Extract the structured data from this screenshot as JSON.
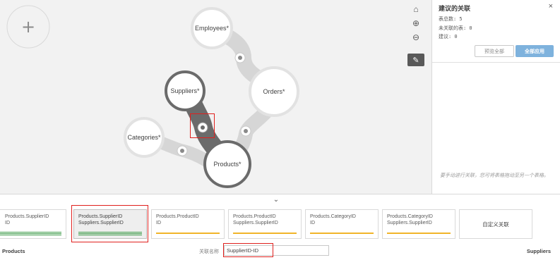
{
  "canvas": {
    "add_button": "+",
    "tables": [
      {
        "name": "Employees*"
      },
      {
        "name": "Suppliers*"
      },
      {
        "name": "Orders*"
      },
      {
        "name": "Categories*"
      },
      {
        "name": "Products*"
      }
    ]
  },
  "toolbar": {
    "home": "⌂",
    "zoom_in": "⊕",
    "zoom_out": "⊖",
    "tools": "✎"
  },
  "panel": {
    "title": "建议的关联",
    "close": "×",
    "total_tables": "表总数: 5",
    "unrelated_tables": "未关联的表: 0",
    "suggestions": "建议: 0",
    "preview_all": "预览全部",
    "apply_all": "全部应用",
    "hint": "要手动进行关联，您可将表格拖动至另一个表格。"
  },
  "bottom": {
    "collapse": "⌄",
    "cards": [
      {
        "line1": "Products.SupplierID",
        "line2": "ID",
        "bar": "green",
        "selected": false
      },
      {
        "line1": "Products.SupplierID",
        "line2": "Suppliers.SupplierID",
        "bar": "green",
        "selected": true
      },
      {
        "line1": "Products.ProductID",
        "line2": "ID",
        "bar": "yellow",
        "selected": false
      },
      {
        "line1": "Products.ProductID",
        "line2": "Suppliers.SupplierID",
        "bar": "yellow",
        "selected": false
      },
      {
        "line1": "Products.CategoryID",
        "line2": "ID",
        "bar": "yellow",
        "selected": false
      },
      {
        "line1": "Products.CategoryID",
        "line2": "Suppliers.SupplierID",
        "bar": "yellow",
        "selected": false
      }
    ],
    "custom_card": "自定义关联",
    "left_table": "Products",
    "right_table": "Suppliers",
    "relation_name_label": "关联名称",
    "relation_name_value": "SupplierID-ID"
  },
  "colors": {
    "accent_blue": "#7eb2dd",
    "highlight_red": "#e0201d",
    "strong_link": "#6b6b6b",
    "weak_link": "#d6d6d6",
    "green_bar": "#3f9c4b",
    "yellow_bar": "#f0b429"
  }
}
